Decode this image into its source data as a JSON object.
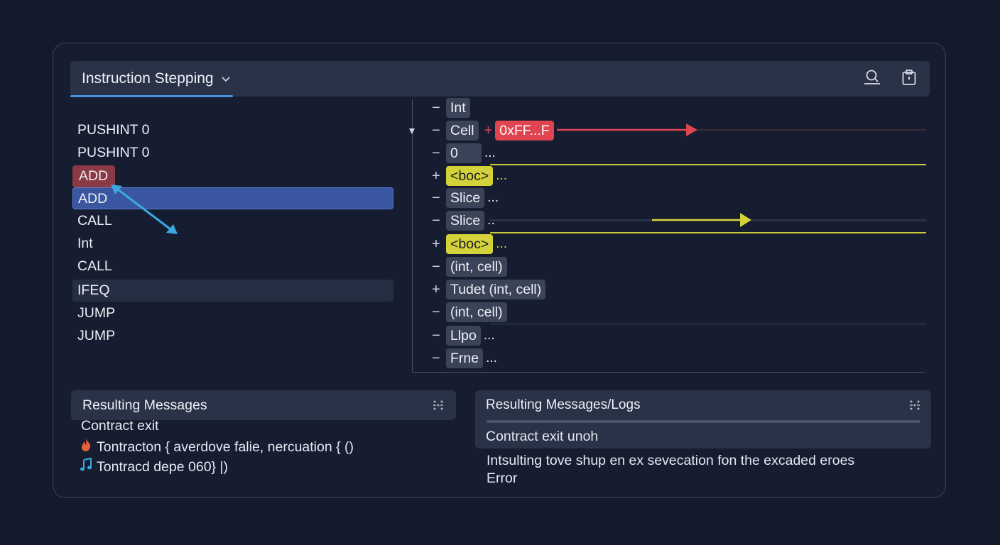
{
  "header": {
    "title": "Instruction Stepping",
    "accent": "#4a90e2"
  },
  "instructions": [
    {
      "label": "PUSHINT 0",
      "state": "normal"
    },
    {
      "label": "PUSHINT 0",
      "state": "normal"
    },
    {
      "label": "ADD",
      "state": "breakpoint"
    },
    {
      "label": "ADD",
      "state": "current"
    },
    {
      "label": "CALL",
      "state": "normal"
    },
    {
      "label": "Int",
      "state": "normal"
    },
    {
      "label": "CALL",
      "state": "normal"
    },
    {
      "label": "IFEQ",
      "state": "hover"
    },
    {
      "label": "JUMP",
      "state": "normal"
    },
    {
      "label": "JUMP",
      "state": "normal"
    }
  ],
  "stack": [
    {
      "sign": "−",
      "label": "Int",
      "style": "grey",
      "ellipsis": ""
    },
    {
      "sign": "−",
      "label": "Cell",
      "style": "grey",
      "ellipsis": "",
      "extra_sign": "+",
      "extra_label": "0xFF...F"
    },
    {
      "sign": "−",
      "label": "0",
      "style": "grey",
      "ellipsis": "..."
    },
    {
      "sign": "+",
      "label": "<boc>",
      "style": "yellow",
      "ellipsis": "..."
    },
    {
      "sign": "−",
      "label": "Slice",
      "style": "grey",
      "ellipsis": "..."
    },
    {
      "sign": "−",
      "label": "Slice",
      "style": "grey",
      "ellipsis": ".."
    },
    {
      "sign": "+",
      "label": "<boc>",
      "style": "yellow",
      "ellipsis": "..."
    },
    {
      "sign": "−",
      "label": "(int, cell)",
      "style": "grey",
      "ellipsis": ""
    },
    {
      "sign": "+",
      "label": "Tudet (int, cell)",
      "style": "grey",
      "ellipsis": ""
    },
    {
      "sign": "−",
      "label": "(int, cell)",
      "style": "grey",
      "ellipsis": ""
    },
    {
      "sign": "−",
      "label": "Llpo",
      "style": "grey",
      "ellipsis": "..."
    },
    {
      "sign": "−",
      "label": "Frne",
      "style": "grey",
      "ellipsis": "..."
    }
  ],
  "messages_left": {
    "title": "Resulting Messages",
    "items": [
      {
        "icon": "",
        "text": "Contract exit"
      },
      {
        "icon": "flame-icon",
        "text": "Tontracton { averdove falie, nercuation { ()"
      },
      {
        "icon": "music-note-icon",
        "text": "Tontracd depe 060} |)"
      }
    ]
  },
  "messages_right": {
    "title": "Resulting Messages/Logs",
    "line1": "Contract exit unoh",
    "line2": "Intsulting tove shup en ex sevecation fon the excaded eroes",
    "line3": "Error"
  },
  "colors": {
    "background": "#131a2c",
    "panel": "#2a3247",
    "red": "#e0444f",
    "yellow": "#d4d23a",
    "cyan_arrow": "#3aa8e0"
  }
}
